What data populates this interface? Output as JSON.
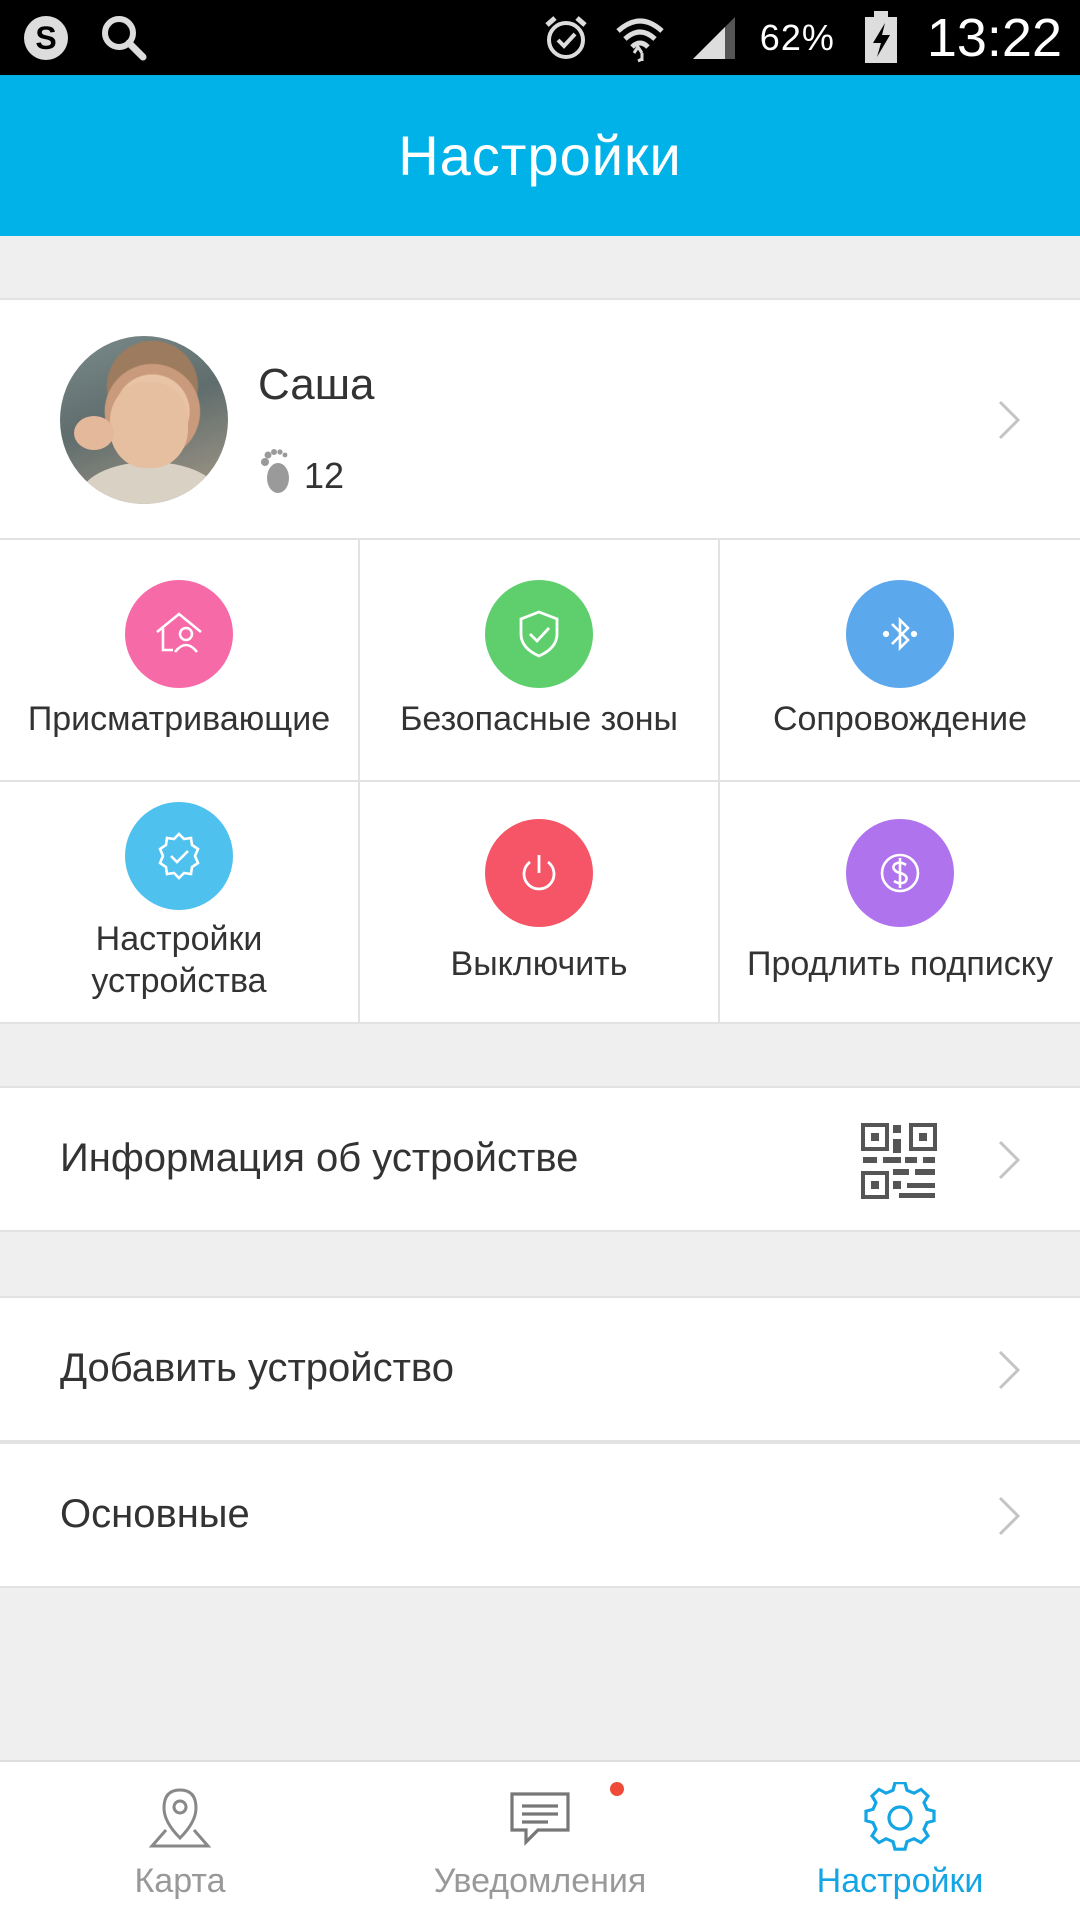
{
  "status_bar": {
    "battery": "62%",
    "time": "13:22"
  },
  "header": {
    "title": "Настройки"
  },
  "profile": {
    "name": "Саша",
    "steps": "12"
  },
  "grid": [
    {
      "label": "Присматривающие",
      "color": "#f76aa8",
      "icon": "family-icon"
    },
    {
      "label": "Безопасные зоны",
      "color": "#5fcf6e",
      "icon": "shield-check-icon"
    },
    {
      "label": "Сопровождение",
      "color": "#5ba8ec",
      "icon": "bluetooth-icon"
    },
    {
      "label": "Настройки устройства",
      "color": "#4fc1ee",
      "icon": "gear-check-icon"
    },
    {
      "label": "Выключить",
      "color": "#f55566",
      "icon": "power-icon"
    },
    {
      "label": "Продлить подписку",
      "color": "#b073ee",
      "icon": "dollar-icon"
    }
  ],
  "rows": {
    "device_info": "Информация об устройстве",
    "add_device": "Добавить устройство",
    "general": "Основные"
  },
  "bottom_nav": {
    "map": "Карта",
    "notifications": "Уведомления",
    "settings": "Настройки",
    "active_color": "#14a5e4"
  }
}
